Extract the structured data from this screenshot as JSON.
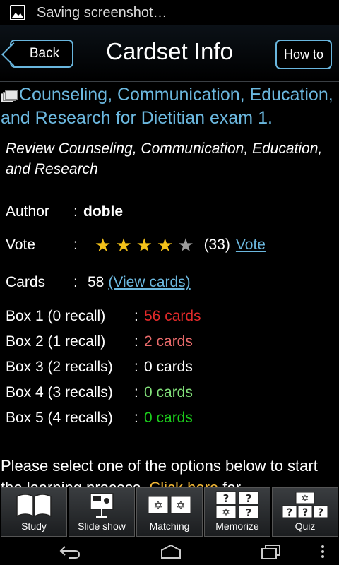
{
  "status": {
    "icon": "image-icon",
    "text": "Saving screenshot…"
  },
  "header": {
    "back_label": "Back",
    "title": "Cardset Info",
    "howto_label": "How to"
  },
  "cardset": {
    "title": "Counseling, Communication, Education, and Research for Dietitian exam 1.",
    "description": "Review Counseling, Communication, Education, and Research",
    "author_label": "Author",
    "author": "doble",
    "vote_label": "Vote",
    "rating": 4,
    "rating_max": 5,
    "vote_count": "(33)",
    "vote_link": "Vote",
    "cards_label": "Cards",
    "cards_count": "58",
    "view_cards": "(View cards)",
    "colon": ":"
  },
  "boxes": [
    {
      "label": "Box 1 (0 recall)",
      "value": "56 cards",
      "color": "#e32a2a"
    },
    {
      "label": "Box 2 (1 recall)",
      "value": "2 cards",
      "color": "#e96b6b"
    },
    {
      "label": "Box 3 (2 recalls)",
      "value": "0 cards",
      "color": "#ffffff"
    },
    {
      "label": "Box 4 (3 recalls)",
      "value": "0 cards",
      "color": "#82e07a"
    },
    {
      "label": "Box 5 (4 recalls)",
      "value": "0 cards",
      "color": "#1ccc1c"
    }
  ],
  "prompt": {
    "text": "Please select one of the options below to start the learning process. ",
    "highlight": "Click here",
    "tail": " for"
  },
  "toolbar": [
    {
      "label": "Study",
      "icon": "book-icon"
    },
    {
      "label": "Slide show",
      "icon": "slideshow-icon"
    },
    {
      "label": "Matching",
      "icon": "matching-icon"
    },
    {
      "label": "Memorize",
      "icon": "memorize-icon"
    },
    {
      "label": "Quiz",
      "icon": "quiz-icon"
    }
  ]
}
